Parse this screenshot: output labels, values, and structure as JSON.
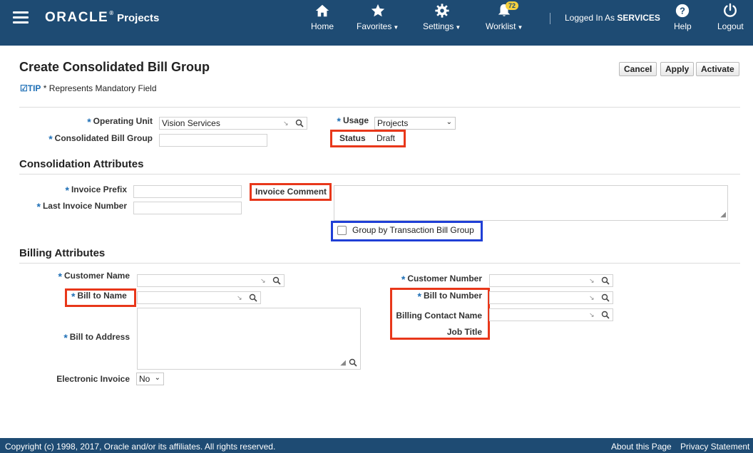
{
  "header": {
    "logo": "ORACLE",
    "logo_reg": "®",
    "product": "Projects",
    "nav": {
      "home": "Home",
      "favorites": "Favorites",
      "settings": "Settings",
      "worklist": "Worklist",
      "worklist_count": "72",
      "help": "Help",
      "logout": "Logout"
    },
    "logged_prefix": "Logged In As",
    "user": "SERVICES"
  },
  "page": {
    "title": "Create Consolidated Bill Group",
    "buttons": {
      "cancel": "Cancel",
      "apply": "Apply",
      "activate": "Activate"
    },
    "tip_label": "TIP",
    "tip_text": "* Represents Mandatory Field"
  },
  "general": {
    "operating_unit_label": "Operating Unit",
    "operating_unit_value": "Vision Services",
    "bill_group_label": "Consolidated Bill Group",
    "bill_group_value": "",
    "usage_label": "Usage",
    "usage_value": "Projects",
    "status_label": "Status",
    "status_value": "Draft"
  },
  "consolidation": {
    "section_title": "Consolidation Attributes",
    "invoice_prefix_label": "Invoice Prefix",
    "last_invoice_number_label": "Last Invoice Number",
    "invoice_comment_label": "Invoice Comment",
    "group_by_label": "Group by Transaction Bill Group",
    "group_by_checked": false
  },
  "billing": {
    "section_title": "Billing Attributes",
    "customer_name_label": "Customer Name",
    "bill_to_name_label": "Bill to Name",
    "bill_to_address_label": "Bill to Address",
    "electronic_invoice_label": "Electronic Invoice",
    "electronic_invoice_value": "No",
    "customer_number_label": "Customer Number",
    "bill_to_number_label": "Bill to Number",
    "billing_contact_label": "Billing Contact Name",
    "job_title_label": "Job Title"
  },
  "footer": {
    "copyright": "Copyright (c) 1998, 2017, Oracle and/or its affiliates. All rights reserved.",
    "about": "About this Page",
    "privacy": "Privacy Statement"
  },
  "colors": {
    "header_bg": "#1e4b73",
    "accent": "#1e6fb6",
    "highlight_red": "#e8371a",
    "highlight_blue": "#1f3fd6"
  }
}
